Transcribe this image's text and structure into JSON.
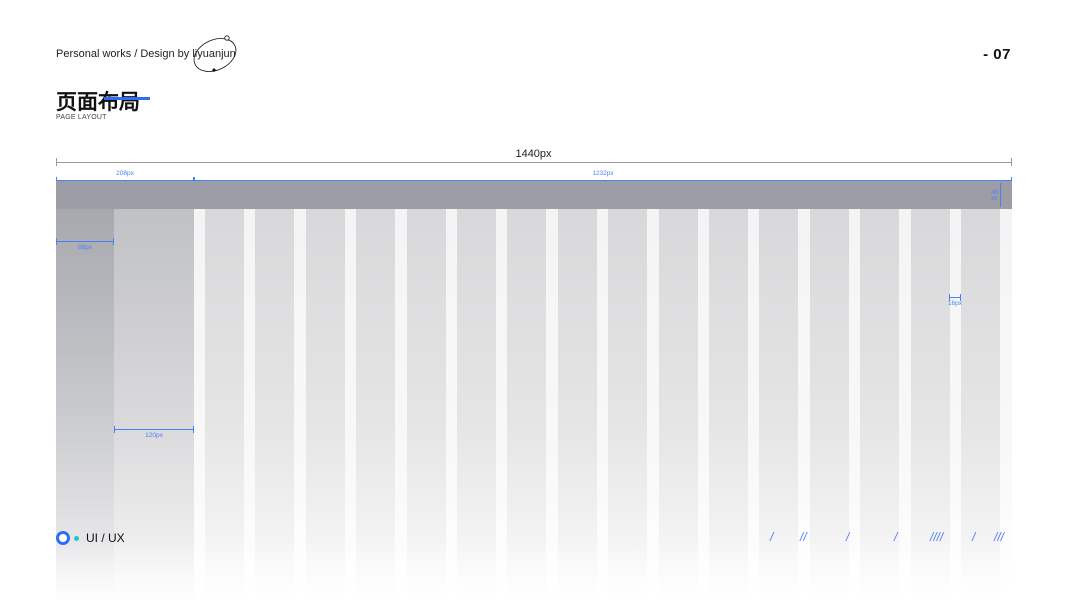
{
  "header": {
    "credit": "Personal works / Design by liyuanjun",
    "page_number": "- 07",
    "title": "页面布局",
    "subtitle": "PAGE LAYOUT"
  },
  "diagram": {
    "total_width_label": "1440px",
    "nav_width_label": "208px",
    "content_width_label": "1232px",
    "topbar_height_label": "48 px",
    "sidebar_width_label": "88px",
    "panel_width_label": "120px",
    "gutter_label": "16px",
    "content_columns": 16
  },
  "footer": {
    "brand_label": "UI / UX",
    "slashes": [
      "/",
      "//",
      "/",
      "/",
      "////",
      "/",
      "///"
    ]
  },
  "colors": {
    "accent": "#2f6df6",
    "dimension": "#4b7ff5",
    "topbar": "#9d9ea5",
    "dot": "#27c3d3"
  }
}
